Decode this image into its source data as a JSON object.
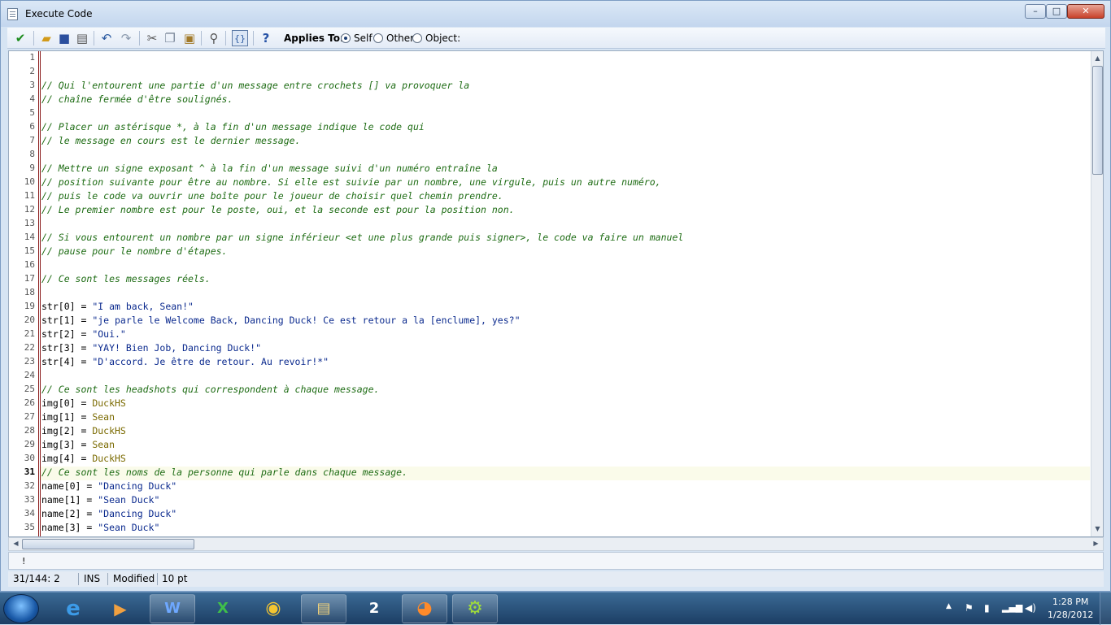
{
  "window": {
    "title": "Execute Code",
    "min": "–",
    "max": "□",
    "close": "✕"
  },
  "toolbar": {
    "applies_to_label": "Applies To:",
    "options": [
      {
        "label": "Self",
        "selected": true
      },
      {
        "label": "Other",
        "selected": false
      },
      {
        "label": "Object:",
        "selected": false
      }
    ]
  },
  "editor": {
    "current_line": 31,
    "lines": [
      {
        "n": "1",
        "t": "",
        "k": "plain"
      },
      {
        "n": "2",
        "t": "",
        "k": "plain"
      },
      {
        "n": "3",
        "t": "// Qui l'entourent une partie d'un message entre crochets [] va provoquer la",
        "k": "cm"
      },
      {
        "n": "4",
        "t": "// chaîne fermée d'être soulignés.",
        "k": "cm"
      },
      {
        "n": "5",
        "t": "",
        "k": "plain"
      },
      {
        "n": "6",
        "t": "// Placer un astérisque *, à la fin d'un message indique le code qui",
        "k": "cm"
      },
      {
        "n": "7",
        "t": "// le message en cours est le dernier message.",
        "k": "cm"
      },
      {
        "n": "8",
        "t": "",
        "k": "plain"
      },
      {
        "n": "9",
        "t": "// Mettre un signe exposant ^ à la fin d'un message suivi d'un numéro entraîne la",
        "k": "cm"
      },
      {
        "n": "10",
        "t": "// position suivante pour être au nombre. Si elle est suivie par un nombre, une virgule, puis un autre numéro,",
        "k": "cm"
      },
      {
        "n": "11",
        "t": "// puis le code va ouvrir une boîte pour le joueur de choisir quel chemin prendre.",
        "k": "cm"
      },
      {
        "n": "12",
        "t": "// Le premier nombre est pour le poste, oui, et la seconde est pour la position non.",
        "k": "cm"
      },
      {
        "n": "13",
        "t": "",
        "k": "plain"
      },
      {
        "n": "14",
        "t": "// Si vous entourent un nombre par un signe inférieur <et une plus grande puis signer>, le code va faire un manuel",
        "k": "cm"
      },
      {
        "n": "15",
        "t": "// pause pour le nombre d'étapes.",
        "k": "cm"
      },
      {
        "n": "16",
        "t": "",
        "k": "plain"
      },
      {
        "n": "17",
        "t": "// Ce sont les messages réels.",
        "k": "cm"
      },
      {
        "n": "18",
        "t": "",
        "k": "plain"
      },
      {
        "n": "19",
        "a": "str[0] = ",
        "b": "\"I am back, Sean!\"",
        "k": "str"
      },
      {
        "n": "20",
        "a": "str[1] = ",
        "b": "\"je parle le Welcome Back, Dancing Duck! Ce est retour a la [enclume], yes?\"",
        "k": "str"
      },
      {
        "n": "21",
        "a": "str[2] = ",
        "b": "\"Oui.\"",
        "k": "str"
      },
      {
        "n": "22",
        "a": "str[3] = ",
        "b": "\"YAY! Bien Job, Dancing Duck!\"",
        "k": "str"
      },
      {
        "n": "23",
        "a": "str[4] = ",
        "b": "\"D'accord. Je être de retour. Au revoir!*\"",
        "k": "str"
      },
      {
        "n": "24",
        "t": "",
        "k": "plain"
      },
      {
        "n": "25",
        "t": "// Ce sont les headshots qui correspondent à chaque message.",
        "k": "cm"
      },
      {
        "n": "26",
        "a": "img[0] = ",
        "b": "DuckHS",
        "k": "res"
      },
      {
        "n": "27",
        "a": "img[1] = ",
        "b": "Sean",
        "k": "res"
      },
      {
        "n": "28",
        "a": "img[2] = ",
        "b": "DuckHS",
        "k": "res"
      },
      {
        "n": "29",
        "a": "img[3] = ",
        "b": "Sean",
        "k": "res"
      },
      {
        "n": "30",
        "a": "img[4] = ",
        "b": "DuckHS",
        "k": "res"
      },
      {
        "n": "31",
        "t": "// Ce sont les noms de la personne qui parle dans chaque message.",
        "k": "cm"
      },
      {
        "n": "32",
        "a": "name[0] = ",
        "b": "\"Dancing Duck\"",
        "k": "str"
      },
      {
        "n": "33",
        "a": "name[1] = ",
        "b": "\"Sean Duck\"",
        "k": "str"
      },
      {
        "n": "34",
        "a": "name[2] = ",
        "b": "\"Dancing Duck\"",
        "k": "str"
      },
      {
        "n": "35",
        "a": "name[3] = ",
        "b": "\"Sean Duck\"",
        "k": "str"
      }
    ]
  },
  "message_pane": {
    "text": "!"
  },
  "status": {
    "position": "31/144:  2",
    "mode": "INS",
    "modified": "Modified",
    "font_size": "10 pt"
  },
  "taskbar": {
    "time": "1:28 PM",
    "date": "1/28/2012"
  },
  "icons": {
    "toolbar": [
      "checkmark-icon",
      "open-folder-icon",
      "save-icon",
      "print-icon",
      "undo-icon",
      "redo-icon",
      "cut-icon",
      "copy-icon",
      "paste-icon",
      "search-icon",
      "code-icon",
      "help-icon"
    ],
    "taskbar": [
      "start-orb-icon",
      "internet-explorer-icon",
      "media-player-icon",
      "word-icon",
      "excel-icon",
      "chrome-icon",
      "file-explorer-icon",
      "app-2k-icon",
      "firefox-icon",
      "game-maker-icon"
    ]
  }
}
